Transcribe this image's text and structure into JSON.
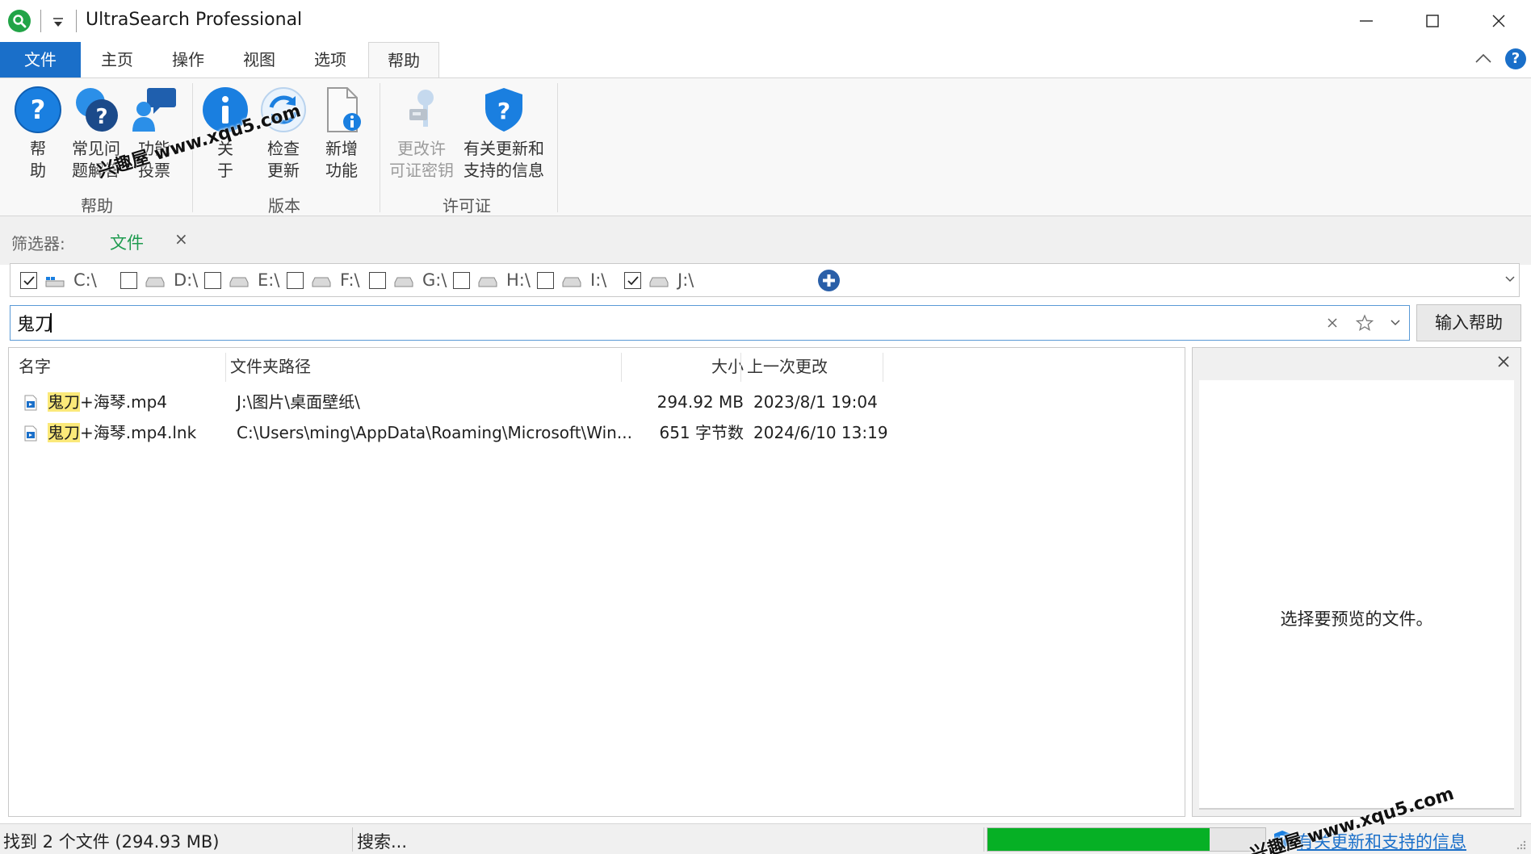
{
  "window": {
    "title": "UltraSearch Professional"
  },
  "ribbon_tabs": [
    {
      "label": "文件"
    },
    {
      "label": "主页"
    },
    {
      "label": "操作"
    },
    {
      "label": "视图"
    },
    {
      "label": "选项"
    },
    {
      "label": "帮助"
    }
  ],
  "ribbon": {
    "help_group": {
      "label": "帮助",
      "help": [
        "帮",
        "助"
      ],
      "faq": [
        "常见问",
        "题解答"
      ],
      "vote": [
        "功能",
        "投票"
      ]
    },
    "version_group": {
      "label": "版本",
      "about": [
        "关",
        "于"
      ],
      "check_update": [
        "检查",
        "更新"
      ],
      "new_features": [
        "新增",
        "功能"
      ]
    },
    "license_group": {
      "label": "许可证",
      "change_key": [
        "更改许",
        "可证密钥"
      ],
      "update_info": [
        "有关更新和",
        "支持的信息"
      ]
    }
  },
  "filter": {
    "label": "筛选器:",
    "value": "文件",
    "clear": "×"
  },
  "drives": [
    {
      "label": "C:\\",
      "checked": true,
      "system": true
    },
    {
      "label": "D:\\",
      "checked": false
    },
    {
      "label": "E:\\",
      "checked": false
    },
    {
      "label": "F:\\",
      "checked": false
    },
    {
      "label": "G:\\",
      "checked": false
    },
    {
      "label": "H:\\",
      "checked": false
    },
    {
      "label": "I:\\",
      "checked": false
    },
    {
      "label": "J:\\",
      "checked": true
    }
  ],
  "search": {
    "value": "鬼刀",
    "input_help": "输入帮助"
  },
  "columns": [
    {
      "label": "名字"
    },
    {
      "label": "文件夹路径"
    },
    {
      "label": "大小"
    },
    {
      "label": "上一次更改"
    }
  ],
  "results": [
    {
      "match": "鬼刀",
      "rest": "+海琴.mp4",
      "path": "J:\\图片\\桌面壁纸\\",
      "size": "294.92 MB",
      "modified": "2023/8/1 19:04"
    },
    {
      "match": "鬼刀",
      "rest": "+海琴.mp4.lnk",
      "path": "C:\\Users\\ming\\AppData\\Roaming\\Microsoft\\Win...",
      "size": "651 字节数",
      "modified": "2024/6/10 13:19"
    }
  ],
  "preview": {
    "message": "选择要预览的文件。"
  },
  "status": {
    "count": "找到 2 个文件 (294.93 MB)",
    "search": "搜索...",
    "progress": 0.8,
    "link": "有关更新和支持的信息"
  },
  "watermarks": [
    "兴趣屋 www.xqu5.com",
    "兴趣屋 www.xqu5.com"
  ],
  "colors": {
    "accent": "#1a6fc9",
    "progress": "#06b025",
    "highlight": "#fbe97a",
    "filter_value": "#1e9b4f"
  }
}
